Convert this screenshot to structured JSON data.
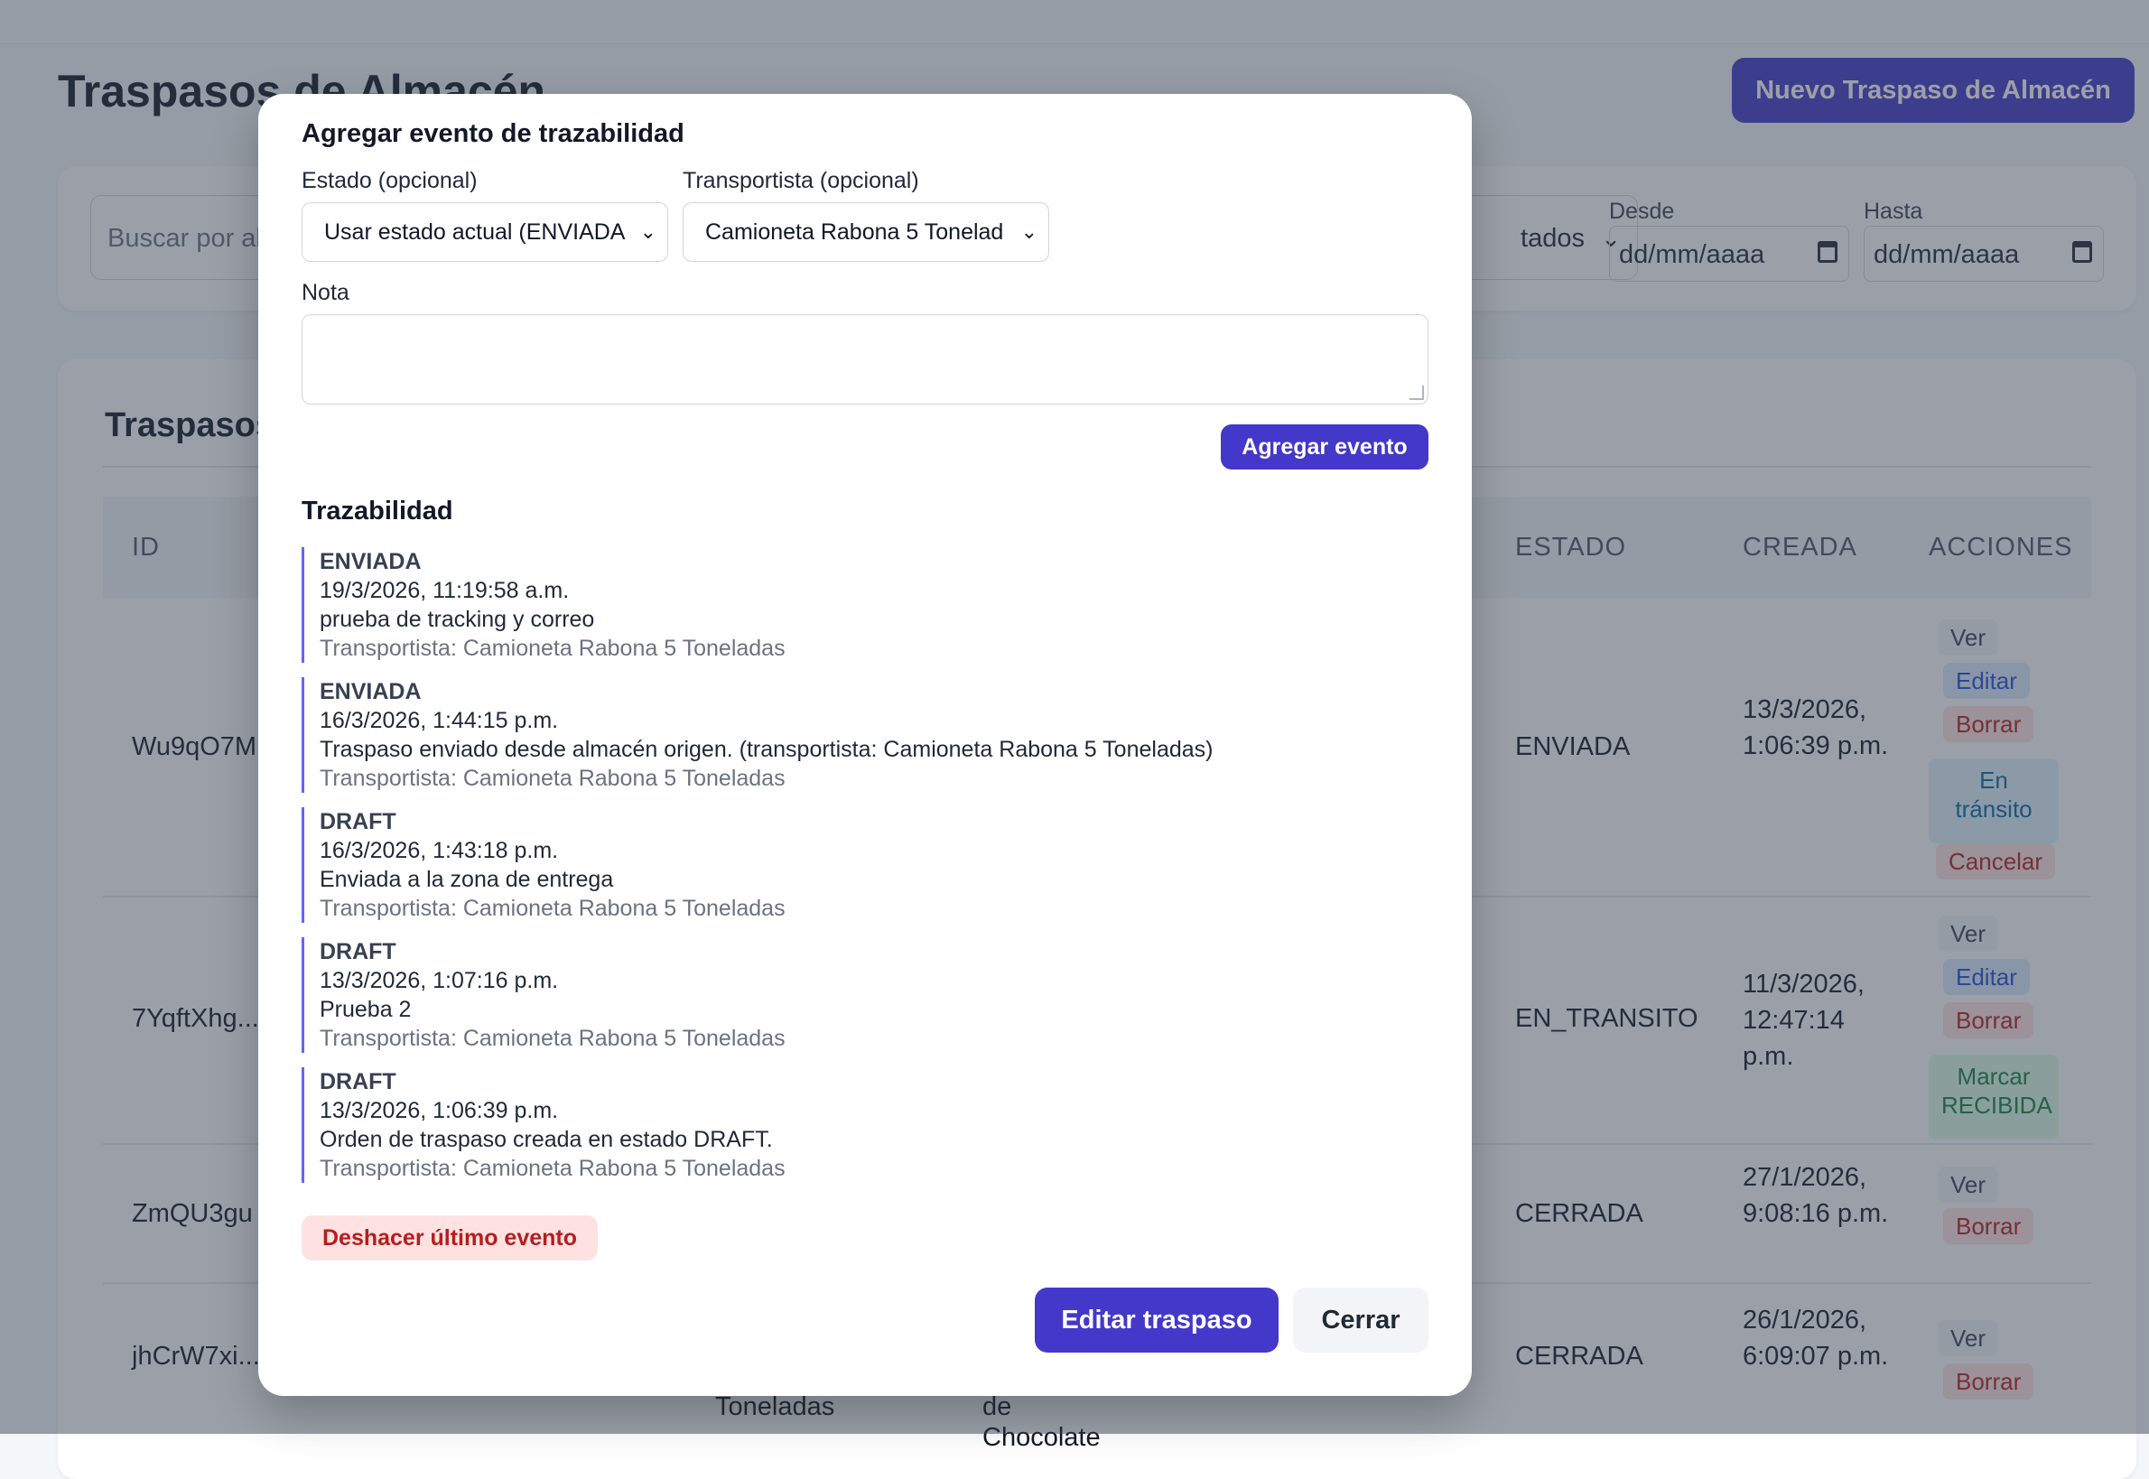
{
  "page": {
    "title": "Traspasos de Almacén",
    "new_button": "Nuevo Traspaso de Almacén"
  },
  "filters": {
    "search_placeholder": "Buscar por al",
    "state_select_visible": "tados",
    "desde_label": "Desde",
    "hasta_label": "Hasta",
    "date_placeholder": "dd/mm/aaaa"
  },
  "table": {
    "title": "Traspasos",
    "headers": [
      "ID",
      "ESTADO",
      "CREADA",
      "ACCIONES"
    ],
    "rows": [
      {
        "id": "Wu9qO7M",
        "estado": "ENVIADA",
        "creada": "13/3/2026, 1:06:39 p.m.",
        "actions": [
          "Ver",
          "Editar",
          "Borrar",
          "En tránsito",
          "Cancelar"
        ]
      },
      {
        "id": "7YqftXhg...",
        "estado": "EN_TRANSITO",
        "creada": "11/3/2026, 12:47:14 p.m.",
        "actions": [
          "Ver",
          "Editar",
          "Borrar",
          "Marcar RECIBIDA"
        ]
      },
      {
        "id": "ZmQU3gu",
        "estado": "CERRADA",
        "creada": "27/1/2026, 9:08:16 p.m.",
        "actions": [
          "Ver",
          "Borrar"
        ]
      },
      {
        "id": "jhCrW7xi...",
        "estado": "CERRADA",
        "creada": "26/1/2026, 6:09:07 p.m.",
        "actions": [
          "Ver",
          "Borrar"
        ],
        "partial_cells": [
          "Toneladas",
          "de",
          "Chocolate"
        ]
      }
    ]
  },
  "modal": {
    "title": "Agregar evento de trazabilidad",
    "estado_label": "Estado (opcional)",
    "estado_value": "Usar estado actual (ENVIADA",
    "transportista_label": "Transportista (opcional)",
    "transportista_value": "Camioneta Rabona 5 Tonelad",
    "nota_label": "Nota",
    "nota_value": "",
    "add_button": "Agregar evento",
    "trazabilidad_title": "Trazabilidad",
    "events": [
      {
        "state": "ENVIADA",
        "datetime": "19/3/2026, 11:19:58 a.m.",
        "note": "prueba de tracking y correo",
        "carrier": "Transportista: Camioneta Rabona 5 Toneladas"
      },
      {
        "state": "ENVIADA",
        "datetime": "16/3/2026, 1:44:15 p.m.",
        "note": "Traspaso enviado desde almacén origen. (transportista: Camioneta Rabona 5 Toneladas)",
        "carrier": "Transportista: Camioneta Rabona 5 Toneladas"
      },
      {
        "state": "DRAFT",
        "datetime": "16/3/2026, 1:43:18 p.m.",
        "note": "Enviada a la zona de entrega",
        "carrier": "Transportista: Camioneta Rabona 5 Toneladas"
      },
      {
        "state": "DRAFT",
        "datetime": "13/3/2026, 1:07:16 p.m.",
        "note": "Prueba 2",
        "carrier": "Transportista: Camioneta Rabona 5 Toneladas"
      },
      {
        "state": "DRAFT",
        "datetime": "13/3/2026, 1:06:39 p.m.",
        "note": "Orden de traspaso creada en estado DRAFT.",
        "carrier": "Transportista: Camioneta Rabona 5 Toneladas"
      }
    ],
    "undo_button": "Deshacer último evento",
    "edit_button": "Editar traspaso",
    "close_button": "Cerrar"
  },
  "colors": {
    "primary": "#4338ca",
    "danger_bg": "#fee2e2",
    "danger_text": "#b91c1c",
    "timeline_accent": "#6366f1"
  }
}
